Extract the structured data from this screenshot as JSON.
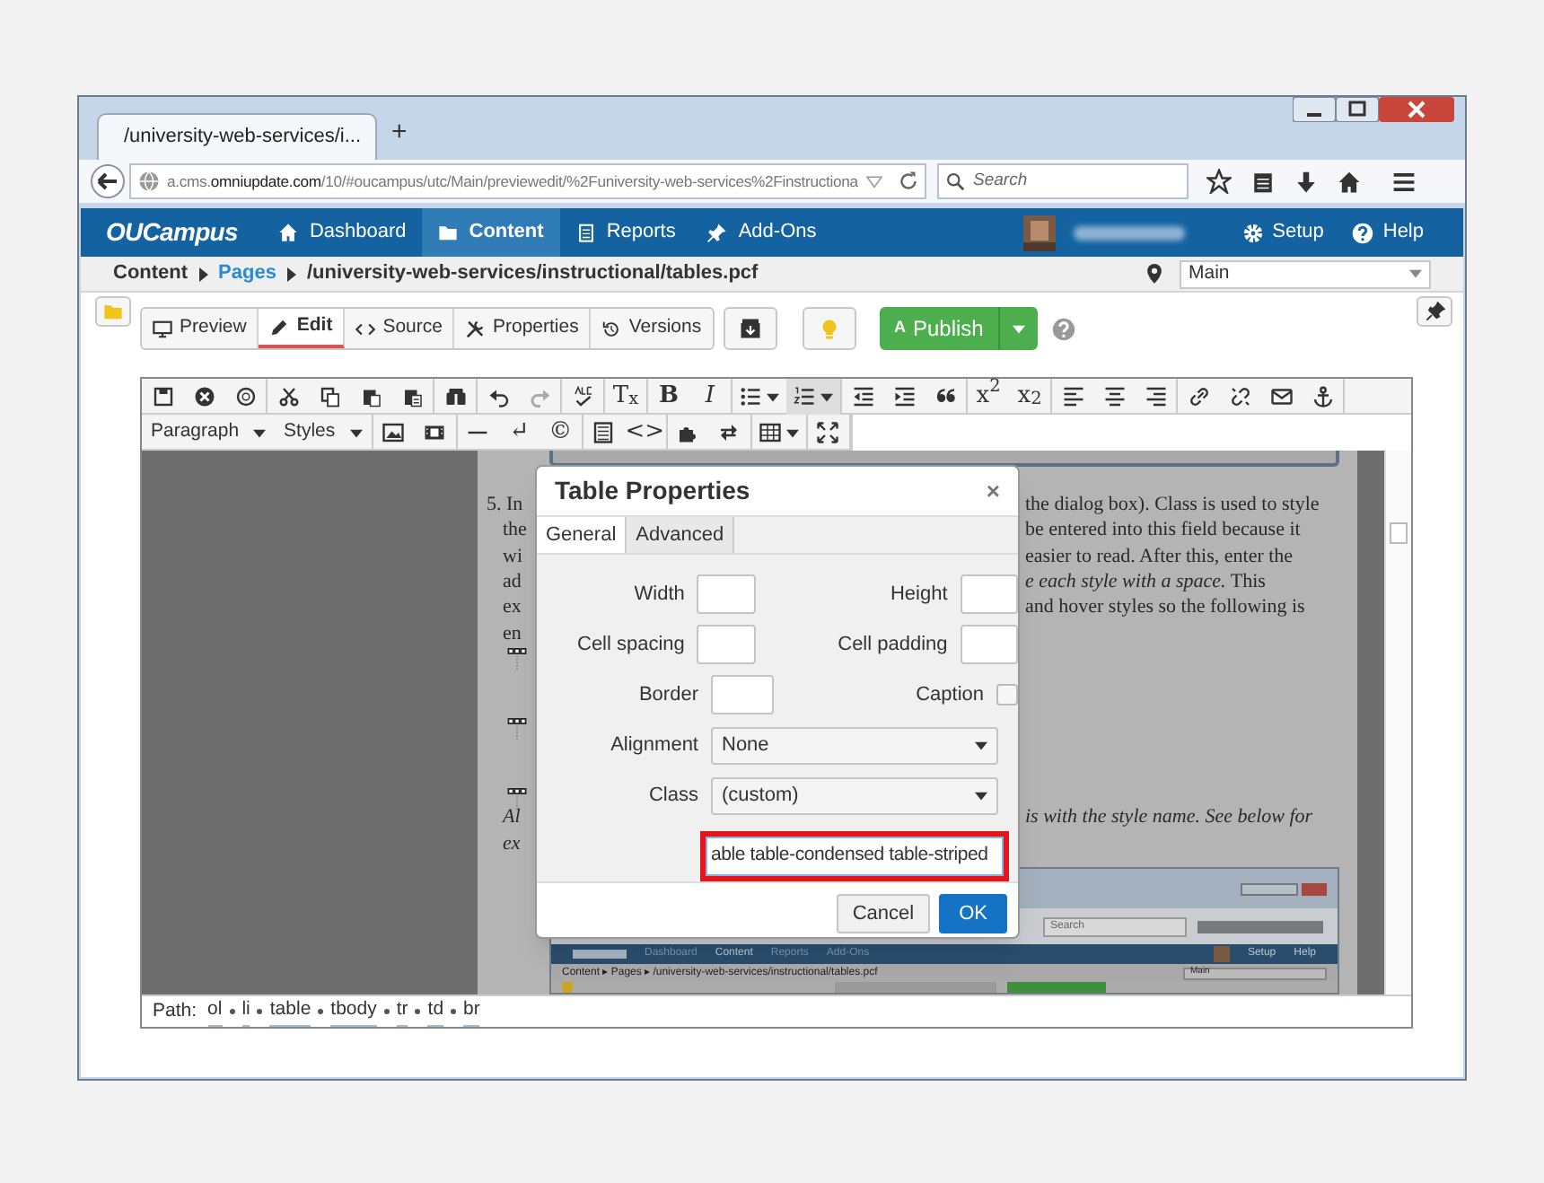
{
  "browser": {
    "tab_title": "/university-web-services/i...",
    "new_tab": "+",
    "url": {
      "prefix": "a.cms.",
      "host": "omniupdate.com",
      "path": "/10/#oucampus/utc/Main/previewedit/%2Funiversity-web-services%2Finstructiona"
    },
    "search_placeholder": "Search"
  },
  "app_nav": {
    "logo": "OUCampus",
    "items": [
      {
        "label": "Dashboard",
        "selected": false
      },
      {
        "label": "Content",
        "selected": true
      },
      {
        "label": "Reports",
        "selected": false
      },
      {
        "label": "Add-Ons",
        "selected": false
      }
    ],
    "right": [
      {
        "label": "Setup"
      },
      {
        "label": "Help"
      }
    ]
  },
  "breadcrumb": [
    {
      "label": "Content",
      "link": false
    },
    {
      "label": "Pages",
      "link": true
    },
    {
      "label": "/university-web-services/instructional/tables.pcf",
      "link": false
    }
  ],
  "site_select": {
    "value": "Main"
  },
  "view_tabs": [
    {
      "label": "Preview",
      "selected": false
    },
    {
      "label": "Edit",
      "selected": true
    },
    {
      "label": "Source",
      "selected": false
    },
    {
      "label": "Properties",
      "selected": false
    },
    {
      "label": "Versions",
      "selected": false
    }
  ],
  "publish": {
    "label": "Publish",
    "glyph": "A"
  },
  "editor": {
    "toolbar_glyphs": [
      "T$_{x}$",
      "B",
      "I",
      "x$^{2}$",
      "x$_{2}$",
      "↵",
      "©",
      "<>"
    ],
    "menus": [
      {
        "label": "Paragraph"
      },
      {
        "label": "Styles"
      }
    ],
    "document": {
      "left": [
        "5. In",
        "the",
        "wi",
        "ad",
        "ex",
        "en"
      ],
      "right": [
        {
          "text": "the dialog box). Class is used to style"
        },
        {
          "text": "be entered into this field because it"
        },
        {
          "text": "easier to read. After this, enter the"
        },
        {
          "text": "*e each style with a space.* This"
        },
        {
          "text": "and hover styles so the following is"
        }
      ],
      "after_left": [
        "Al",
        "ex"
      ],
      "after_right": "is with the style name. See below for",
      "screenshot": {
        "search": "Search",
        "nav": [
          "Dashboard",
          "Content",
          "Reports",
          "Add-Ons"
        ],
        "nav_right": [
          "Setup",
          "Help"
        ],
        "breadcrumb": "Content ▸ Pages ▸ /university-web-services/instructional/tables.pcf",
        "site": "Main"
      }
    },
    "path": {
      "label": "Path:",
      "elements": [
        "ol",
        "li",
        "table",
        "tbody",
        "tr",
        "td",
        "br"
      ]
    }
  },
  "dialog": {
    "title": "Table Properties",
    "close": "×",
    "tabs": [
      {
        "label": "General",
        "selected": true
      },
      {
        "label": "Advanced",
        "selected": false
      }
    ],
    "rows": [
      [
        {
          "label": "Width",
          "kind": "text"
        },
        {
          "label": "Height",
          "kind": "text"
        }
      ],
      [
        {
          "label": "Cell spacing",
          "kind": "text"
        },
        {
          "label": "Cell padding",
          "kind": "text"
        }
      ],
      [
        {
          "label": "Border",
          "kind": "text"
        },
        {
          "label": "Caption",
          "kind": "checkbox",
          "checked": false
        }
      ],
      [
        {
          "label": "Alignment",
          "kind": "select",
          "value": "None"
        }
      ],
      [
        {
          "label": "Class",
          "kind": "select",
          "value": "(custom)"
        }
      ]
    ],
    "class_value": "able table-condensed table-striped",
    "class_highlighted": true,
    "buttons": [
      {
        "label": "Cancel",
        "primary": false
      },
      {
        "label": "OK",
        "primary": true
      }
    ]
  }
}
